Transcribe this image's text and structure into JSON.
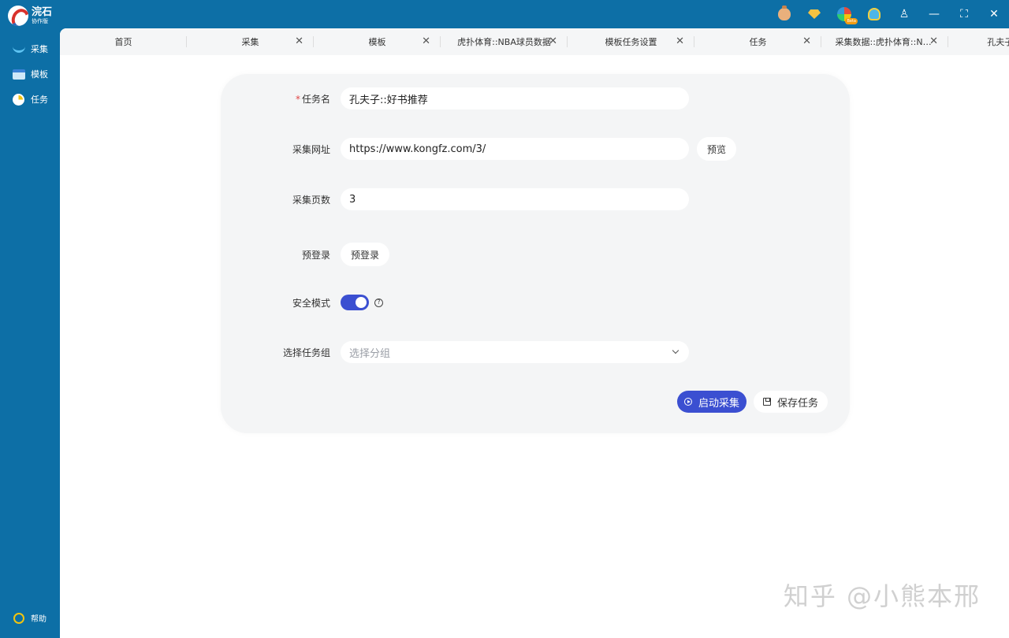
{
  "app": {
    "title": "浣石",
    "subtitle": "协作版"
  },
  "topbar": {
    "icons": [
      "money-bag-icon",
      "diamond-icon",
      "beta-icon",
      "notification-bell-icon",
      "user-icon",
      "minimize-icon",
      "maximize-icon",
      "close-icon"
    ],
    "beta_tag": "Beta",
    "user_glyph": "♙",
    "min_glyph": "—",
    "max_glyph": "⛶",
    "close_glyph": "✕"
  },
  "sidebar": {
    "items": [
      {
        "label": "采集",
        "icon": "collect-icon"
      },
      {
        "label": "模板",
        "icon": "template-icon"
      },
      {
        "label": "任务",
        "icon": "task-icon"
      }
    ],
    "help_label": "帮助"
  },
  "tabs": [
    {
      "label": "首页",
      "closable": false
    },
    {
      "label": "采集",
      "closable": true
    },
    {
      "label": "模板",
      "closable": true
    },
    {
      "label": "虎扑体育::NBA球员数据",
      "closable": true
    },
    {
      "label": "模板任务设置",
      "closable": true
    },
    {
      "label": "任务",
      "closable": true
    },
    {
      "label": "采集数据::虎扑体育::NBA...",
      "closable": true
    },
    {
      "label": "孔夫子::好书",
      "closable": false
    }
  ],
  "tab_close_glyph": "✕",
  "form": {
    "task_name": {
      "required_mark": "*",
      "label": "任务名",
      "value": "孔夫子::好书推荐"
    },
    "collect_url": {
      "label": "采集网址",
      "value": "https://www.kongfz.com/3/",
      "preview_button": "预览"
    },
    "page_count": {
      "label": "采集页数",
      "value": "3"
    },
    "pre_login": {
      "label": "预登录",
      "button": "预登录"
    },
    "safe_mode": {
      "label": "安全模式",
      "enabled": true,
      "help_glyph": "?"
    },
    "task_group": {
      "label": "选择任务组",
      "placeholder": "选择分组"
    }
  },
  "actions": {
    "start_label": "启动采集",
    "save_label": "保存任务"
  },
  "colors": {
    "sidebar": "#0d6fa6",
    "primary": "#3b4fd1",
    "card": "#f4f5f6"
  },
  "watermark": "知乎 @小熊本邢"
}
